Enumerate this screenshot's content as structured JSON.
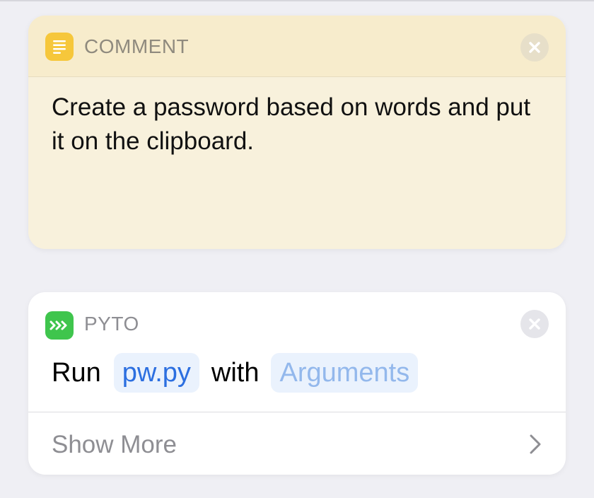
{
  "comment_card": {
    "app_icon": "text-lines-icon",
    "title": "COMMENT",
    "text": "Create a password based on words and put it on the clipboard.",
    "close_icon": "close-circle-icon",
    "colors": {
      "header": "#f7eccc",
      "body": "#f8f1dc",
      "icon": "#f6c73b"
    }
  },
  "pyto_card": {
    "app_icon": "pyto-chevrons-icon",
    "title": "PYTO",
    "close_icon": "close-circle-icon",
    "action": {
      "verb": "Run",
      "file_token": "pw.py",
      "connector": "with",
      "arguments_token": "Arguments"
    },
    "show_more_label": "Show More",
    "show_more_icon": "chevron-right-icon",
    "colors": {
      "icon": "#3fc54d",
      "token_bg": "#eaf2fd",
      "token_text": "#2c6fe0",
      "placeholder_text": "#93b8ec"
    }
  }
}
